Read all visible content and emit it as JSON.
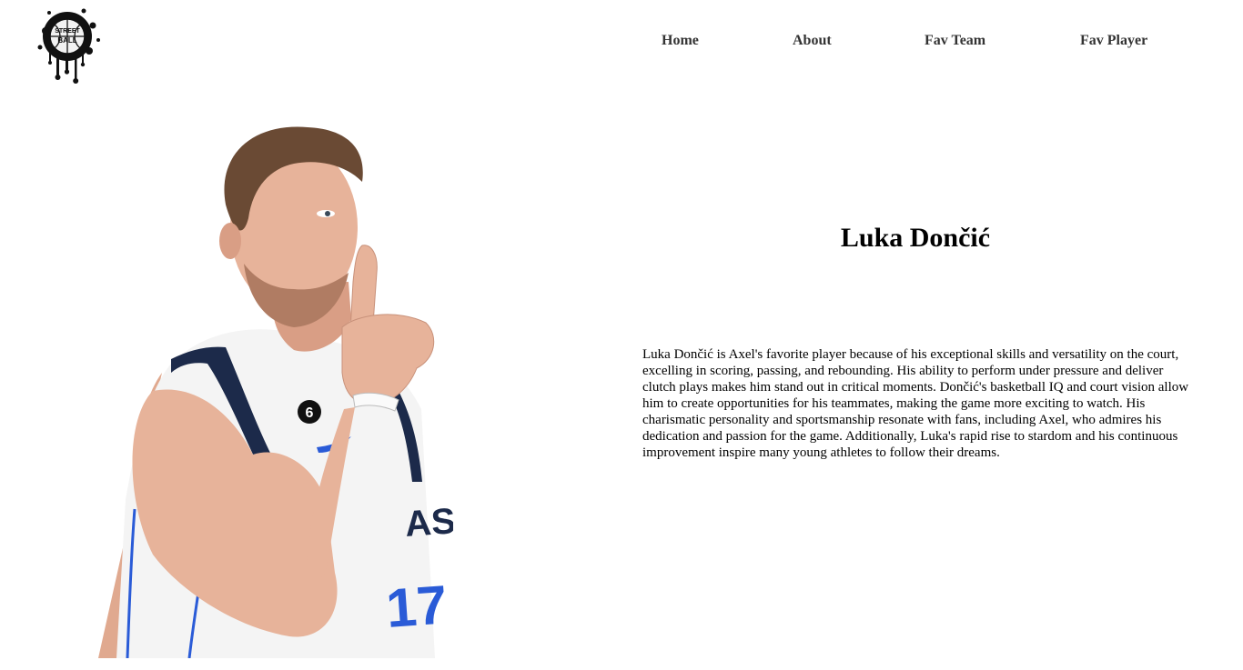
{
  "header": {
    "logo_icon": "street-ball-logo-icon",
    "logo_text": "STREET BALL",
    "nav": [
      {
        "label": "Home"
      },
      {
        "label": "About"
      },
      {
        "label": "Fav Team"
      },
      {
        "label": "Fav Player"
      }
    ]
  },
  "player": {
    "name": "Luka Dončić",
    "photo_icon": "player-photo-image",
    "jersey_number": "6",
    "description": "Luka Dončić is Axel's favorite player because of his exceptional skills and versatility on the court, excelling in scoring, passing, and rebounding. His ability to perform under pressure and deliver clutch plays makes him stand out in critical moments. Dončić's basketball IQ and court vision allow him to create opportunities for his teammates, making the game more exciting to watch. His charismatic personality and sportsmanship resonate with fans, including Axel, who admires his dedication and passion for the game. Additionally, Luka's rapid rise to stardom and his continuous improvement inspire many young athletes to follow their dreams."
  },
  "colors": {
    "nav_text": "#333333",
    "jersey_white": "#f4f4f4",
    "jersey_navy": "#1c2a4a",
    "jersey_blue": "#2a5bd7",
    "skin": "#e7b39a",
    "hair": "#6a4a34"
  }
}
